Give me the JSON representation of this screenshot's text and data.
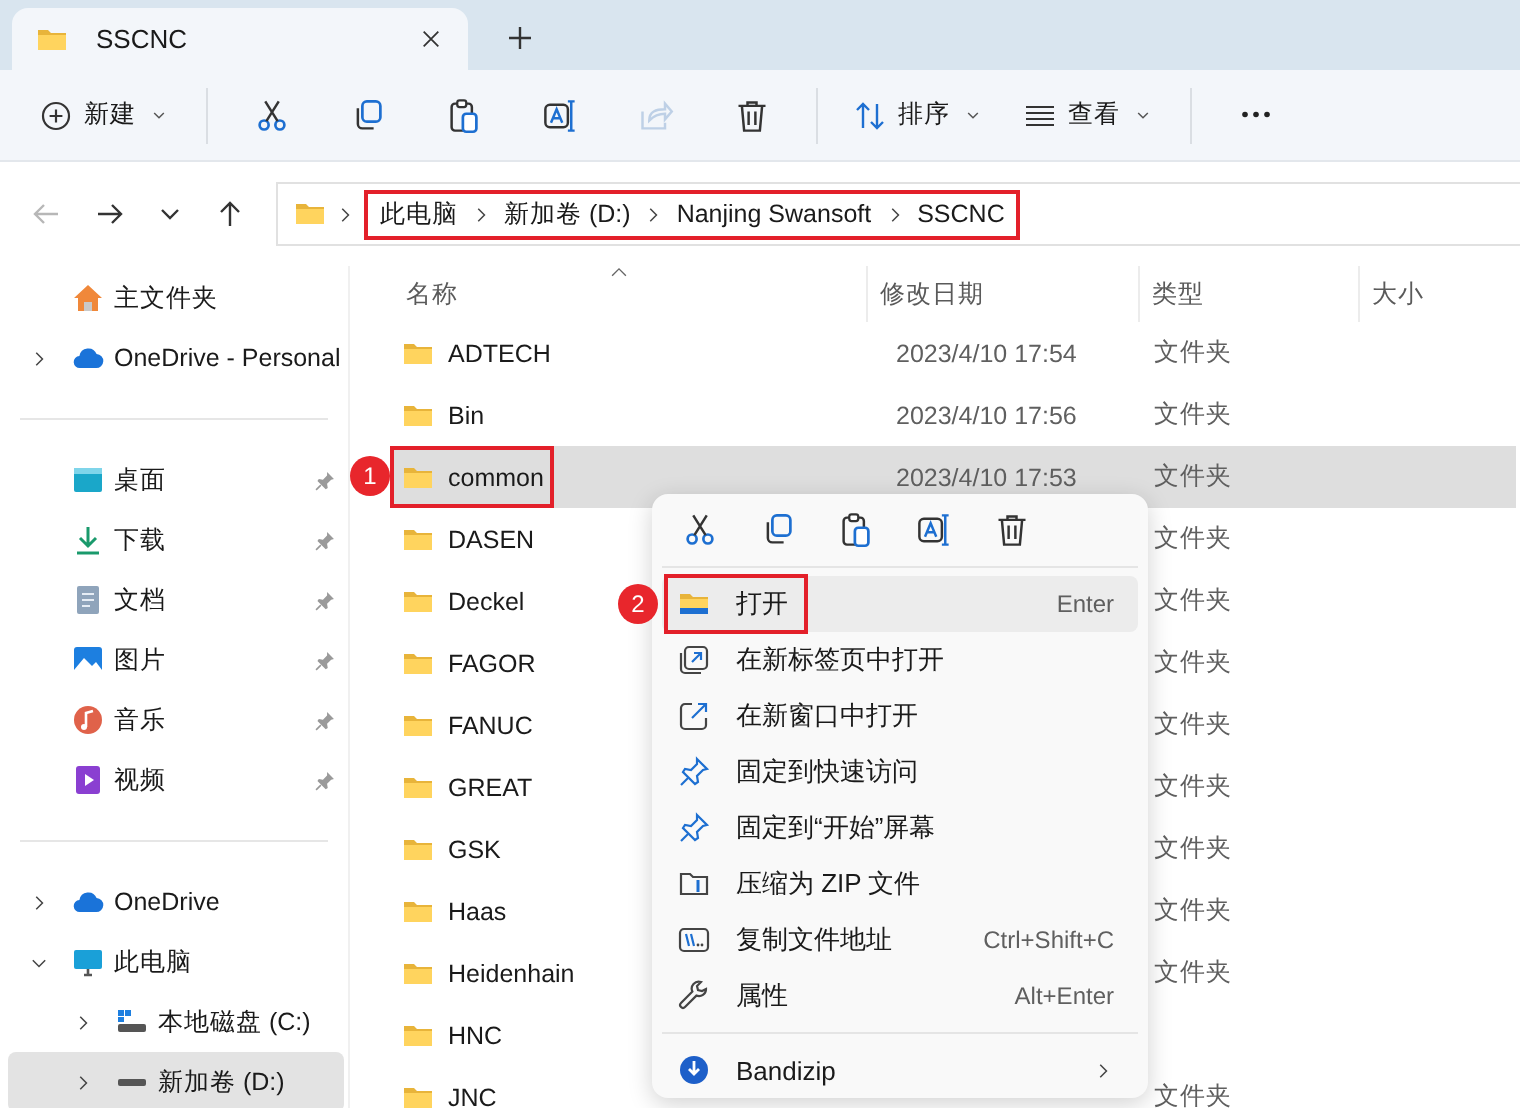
{
  "tab": {
    "title": "SSCNC"
  },
  "toolbar": {
    "new_label": "新建",
    "sort_label": "排序",
    "view_label": "查看",
    "tools": [
      {
        "kind": "cut",
        "disabled": false
      },
      {
        "kind": "copy",
        "disabled": false
      },
      {
        "kind": "paste",
        "disabled": false
      },
      {
        "kind": "rename",
        "disabled": false
      },
      {
        "kind": "share",
        "disabled": true
      },
      {
        "kind": "delete",
        "disabled": false
      }
    ]
  },
  "nav": [
    {
      "kind": "back",
      "disabled": true
    },
    {
      "kind": "forward",
      "disabled": false
    },
    {
      "kind": "recent",
      "disabled": false
    },
    {
      "kind": "up",
      "disabled": false
    }
  ],
  "address": {
    "outlined": true,
    "crumbs": [
      "此电脑",
      "新加卷 (D:)",
      "Nanjing Swansoft",
      "SSCNC"
    ]
  },
  "sidebar": {
    "groups": [
      [
        {
          "label": "主文件夹",
          "kind": "home",
          "selected": false
        },
        {
          "label": "OneDrive - Personal",
          "kind": "cloud",
          "expanded": false,
          "selected": false
        }
      ],
      [
        {
          "label": "桌面",
          "kind": "desktop",
          "pinned": true,
          "selected": false
        },
        {
          "label": "下载",
          "kind": "download",
          "pinned": true,
          "selected": false
        },
        {
          "label": "文档",
          "kind": "documents",
          "pinned": true,
          "selected": false
        },
        {
          "label": "图片",
          "kind": "pictures",
          "pinned": true,
          "selected": false
        },
        {
          "label": "音乐",
          "kind": "music",
          "pinned": true,
          "selected": false
        },
        {
          "label": "视频",
          "kind": "videos",
          "pinned": true,
          "selected": false
        }
      ],
      [
        {
          "label": "OneDrive",
          "kind": "cloud",
          "expanded": false,
          "selected": false
        },
        {
          "label": "此电脑",
          "kind": "pc",
          "expanded": true,
          "selected": false,
          "children": [
            {
              "label": "本地磁盘 (C:)",
              "kind": "drive-c",
              "expanded": false,
              "selected": false
            },
            {
              "label": "新加卷 (D:)",
              "kind": "drive",
              "expanded": false,
              "selected": true
            }
          ]
        }
      ]
    ]
  },
  "columns": [
    {
      "label": "名称",
      "sorted": true
    },
    {
      "label": "修改日期",
      "sorted": false
    },
    {
      "label": "类型",
      "sorted": false
    },
    {
      "label": "大小",
      "sorted": false
    }
  ],
  "rows": [
    {
      "name": "ADTECH",
      "date": "2023/4/10 17:54",
      "type": "文件夹",
      "selected": false
    },
    {
      "name": "Bin",
      "date": "2023/4/10 17:56",
      "type": "文件夹",
      "selected": false
    },
    {
      "name": "common",
      "date": "2023/4/10 17:53",
      "type": "文件夹",
      "selected": true,
      "outlined": true,
      "callout": "1"
    },
    {
      "name": "DASEN",
      "type": "文件夹",
      "selected": false
    },
    {
      "name": "Deckel",
      "type": "文件夹",
      "selected": false
    },
    {
      "name": "FAGOR",
      "type": "文件夹",
      "selected": false
    },
    {
      "name": "FANUC",
      "type": "文件夹",
      "selected": false
    },
    {
      "name": "GREAT",
      "type": "文件夹",
      "selected": false
    },
    {
      "name": "GSK",
      "type": "文件夹",
      "selected": false
    },
    {
      "name": "Haas",
      "type": "文件夹",
      "selected": false
    },
    {
      "name": "Heidenhain",
      "type": "文件夹",
      "selected": false
    },
    {
      "name": "HNC",
      "selected": false
    },
    {
      "name": "JNC",
      "type": "文件夹",
      "selected": false
    }
  ],
  "context_menu": {
    "quick_actions": [
      {
        "kind": "cut"
      },
      {
        "kind": "copy"
      },
      {
        "kind": "paste"
      },
      {
        "kind": "rename"
      },
      {
        "kind": "delete"
      }
    ],
    "items": [
      {
        "label": "打开",
        "shortcut": "Enter",
        "kind": "open",
        "selected": true,
        "outlined": true,
        "callout": "2"
      },
      {
        "label": "在新标签页中打开",
        "kind": "new-tab",
        "selected": false
      },
      {
        "label": "在新窗口中打开",
        "kind": "new-window",
        "selected": false
      },
      {
        "label": "固定到快速访问",
        "kind": "pin",
        "selected": false
      },
      {
        "label": "固定到“开始”屏幕",
        "kind": "pin",
        "selected": false
      },
      {
        "label": "压缩为 ZIP 文件",
        "kind": "zip",
        "selected": false
      },
      {
        "label": "复制文件地址",
        "shortcut": "Ctrl+Shift+C",
        "kind": "path",
        "selected": false
      },
      {
        "label": "属性",
        "shortcut": "Alt+Enter",
        "kind": "wrench",
        "selected": false
      }
    ],
    "extra_items": [
      {
        "label": "Bandizip",
        "kind": "bandizip",
        "has_submenu": true
      }
    ]
  }
}
